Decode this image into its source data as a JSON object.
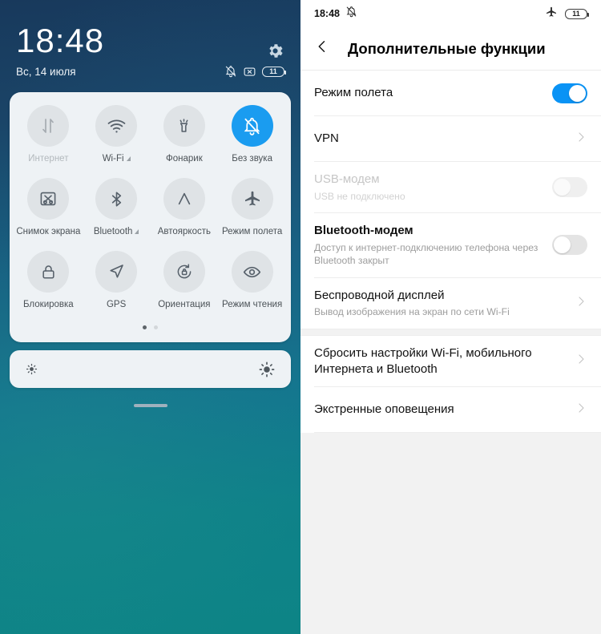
{
  "shade": {
    "clock": "18:48",
    "date": "Вс, 14 июля",
    "battery": "11",
    "toggles": [
      [
        {
          "label": "Интернет",
          "icon": "data-transfer-icon",
          "state": "disabled",
          "indicator": false
        },
        {
          "label": "Wi-Fi",
          "icon": "wifi-icon",
          "state": "off",
          "indicator": true
        },
        {
          "label": "Фонарик",
          "icon": "flashlight-icon",
          "state": "off",
          "indicator": false
        },
        {
          "label": "Без звука",
          "icon": "bell-muted-icon",
          "state": "active",
          "indicator": false
        }
      ],
      [
        {
          "label": "Снимок экрана",
          "icon": "screenshot-icon",
          "state": "off",
          "indicator": false
        },
        {
          "label": "Bluetooth",
          "icon": "bluetooth-icon",
          "state": "off",
          "indicator": true
        },
        {
          "label": "Автояркость",
          "icon": "auto-brightness-icon",
          "state": "off",
          "indicator": false
        },
        {
          "label": "Режим полета",
          "icon": "airplane-icon",
          "state": "off",
          "indicator": false
        }
      ],
      [
        {
          "label": "Блокировка",
          "icon": "lock-icon",
          "state": "off",
          "indicator": false
        },
        {
          "label": "GPS",
          "icon": "location-arrow-icon",
          "state": "off",
          "indicator": false
        },
        {
          "label": "Ориентация",
          "icon": "rotation-lock-icon",
          "state": "off",
          "indicator": false
        },
        {
          "label": "Режим чтения",
          "icon": "eye-icon",
          "state": "off",
          "indicator": false
        }
      ]
    ],
    "page_dots": {
      "count": 2,
      "active": 1
    },
    "brightness": {
      "min_icon": "brightness-low-icon",
      "max_icon": "brightness-high-icon"
    }
  },
  "settings": {
    "status_time": "18:48",
    "status_battery": "11",
    "title": "Дополнительные функции",
    "rows": [
      {
        "label": "Режим полета",
        "sub": null,
        "control": "switch-on",
        "disabled": false,
        "bold": false
      },
      {
        "label": "VPN",
        "sub": null,
        "control": "chevron",
        "disabled": false,
        "bold": false
      },
      {
        "label": "USB-модем",
        "sub": "USB не подключено",
        "control": "switch-off-dim",
        "disabled": true,
        "bold": false
      },
      {
        "label": "Bluetooth-модем",
        "sub": "Доступ к интернет-подключению телефона через Bluetooth закрыт",
        "control": "switch-off",
        "disabled": false,
        "bold": true
      },
      {
        "label": "Беспроводной дисплей",
        "sub": "Вывод изображения на экран по сети Wi-Fi",
        "control": "chevron",
        "disabled": false,
        "bold": false
      },
      {
        "label": "Сбросить настройки Wi-Fi, мобильного Интернета и Bluetooth",
        "sub": null,
        "control": "chevron",
        "disabled": false,
        "bold": false
      },
      {
        "label": "Экстренные оповещения",
        "sub": null,
        "control": "chevron",
        "disabled": false,
        "bold": false
      }
    ],
    "section_break_after_index": 4
  },
  "colors": {
    "accent": "#0a93f5",
    "toggle_active": "#1a9cf0"
  }
}
